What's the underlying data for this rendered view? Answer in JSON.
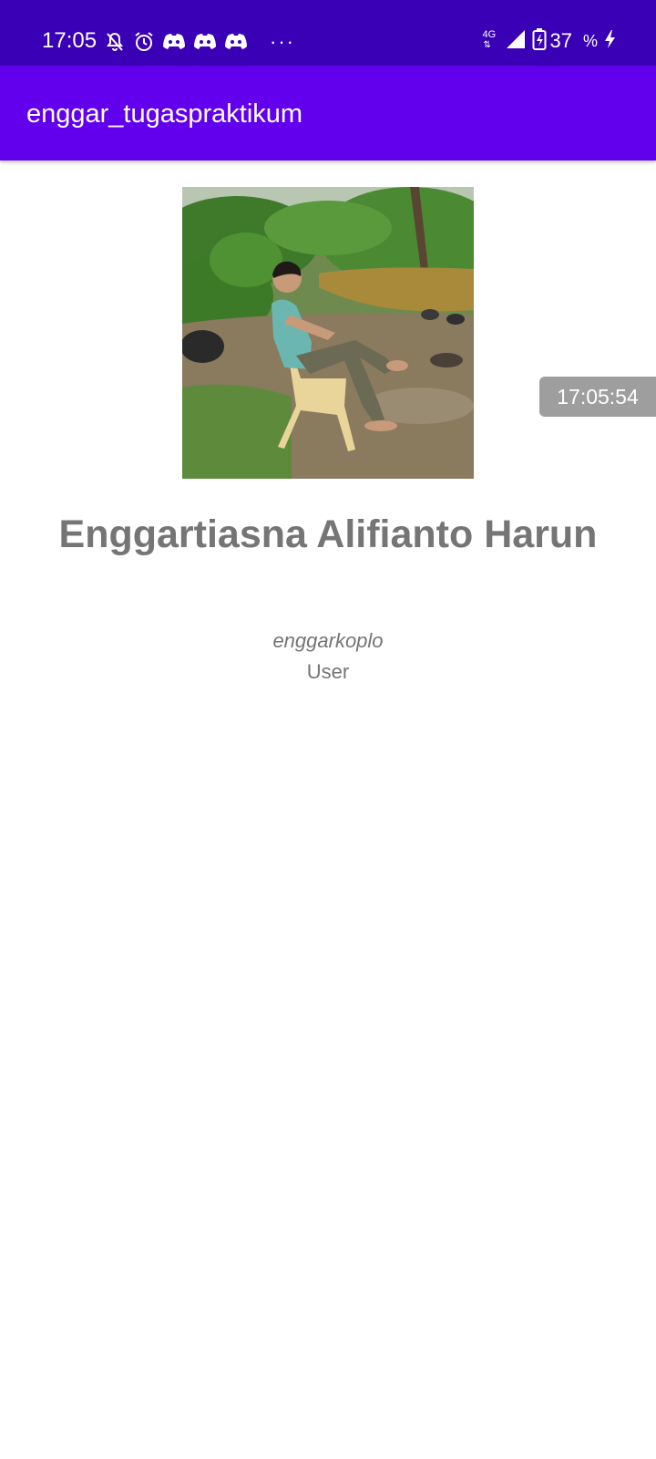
{
  "status_bar": {
    "time": "17:05",
    "icons": [
      "bell-off-icon",
      "alarm-icon",
      "discord-icon",
      "discord-icon",
      "discord-icon"
    ],
    "more": "···",
    "network_type": "4G",
    "battery_level": "37",
    "battery_suffix": "%"
  },
  "app_bar": {
    "title": "enggar_tugaspraktikum"
  },
  "profile": {
    "full_name": "Enggartiasna Alifianto Harun",
    "username": "enggarkoplo",
    "role": "User"
  },
  "toast": {
    "text": "17:05:54"
  },
  "colors": {
    "status_bar": "#3a00b5",
    "app_bar": "#6200ee",
    "text_gray": "#757575",
    "toast_bg": "#9e9e9e"
  }
}
